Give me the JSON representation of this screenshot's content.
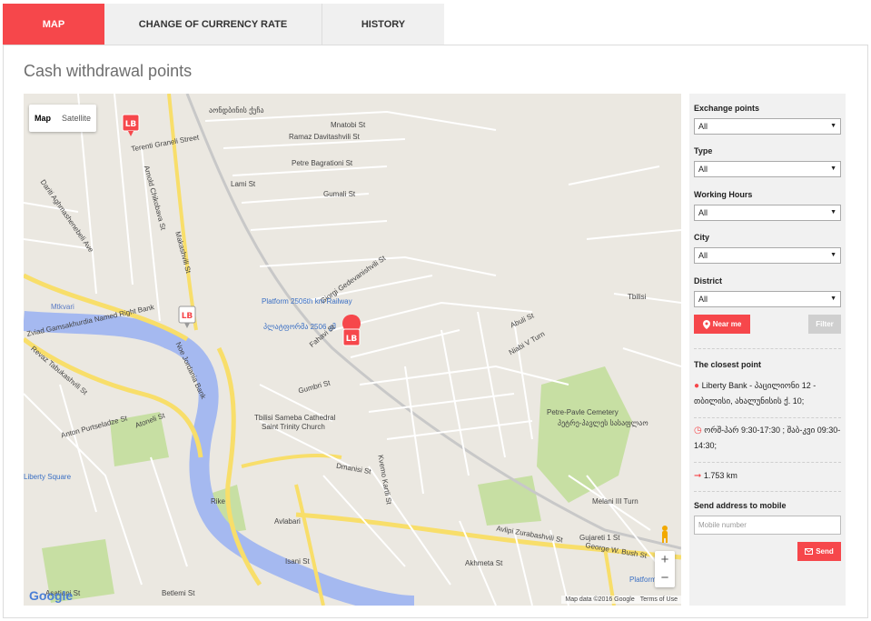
{
  "tabs": [
    {
      "label": "MAP",
      "active": true
    },
    {
      "label": "CHANGE OF CURRENCY RATE",
      "active": false
    },
    {
      "label": "HISTORY",
      "active": false
    }
  ],
  "page_title": "Cash withdrawal points",
  "map": {
    "map_type": {
      "map": "Map",
      "satellite": "Satellite"
    },
    "zoom": {
      "in": "+",
      "out": "−"
    },
    "logo": "Google",
    "attribution": {
      "data": "Map data ©2016 Google",
      "terms": "Terms of Use"
    },
    "labels": {
      "l1": "აონდბინის ქუჩა",
      "l2": "Mnatobi St",
      "l3": "Ramaz Davitashvili St",
      "l4": "Terenti Graneli Street",
      "l5": "Petre Bagrationi St",
      "l6": "Lami St",
      "l7": "Gumali St",
      "l8": "Arnold Chikobava St",
      "l9": "Dariti Aghmashenebeli Ave",
      "l10": "Makashvili St",
      "l11": "Giorgi Gedevanishvili St",
      "l12": "Platform 2506th km Railway",
      "l13": "პლატფორმა 2506 კმ",
      "l14": "Mtkvari",
      "l15": "Zviad Gamsakhurdia Named Right Bank",
      "l16": "Noe Jordania Bank",
      "l17": "Revaz Tabukashvili St",
      "l18": "Anton Purtseladze St",
      "l19": "Atoneli St",
      "l20": "Tbilisi Sameba Cathedral",
      "l21": "Saint Trinity Church",
      "l22": "Gumbri St",
      "l23": "Fahavi St",
      "l24": "Abuli St",
      "l25": "Niabi V Turn",
      "l26": "Petre-Pavle Cemetery",
      "l27": "პეტრე-პავლეს სასაფლაო",
      "l28": "Tbilisi",
      "l29": "Rike",
      "l30": "Avlabari",
      "l31": "Isani St",
      "l32": "Akhmeta St",
      "l33": "Avlipi Zurabashvili St",
      "l34": "George W. Bush St",
      "l35": "Liberty Square",
      "l36": "Gujareti 1 St",
      "l37": "Melani III Turn",
      "l38": "Betlemi St",
      "l39": "Asatiani St",
      "l40": "Platform",
      "l41": "Kvemo Kartli St",
      "l42": "Dmanisi St"
    }
  },
  "filters": {
    "exchange_points": {
      "label": "Exchange points",
      "value": "All"
    },
    "type": {
      "label": "Type",
      "value": "All"
    },
    "working_hours": {
      "label": "Working Hours",
      "value": "All"
    },
    "city": {
      "label": "City",
      "value": "All"
    },
    "district": {
      "label": "District",
      "value": "All"
    },
    "near_me": "Near me",
    "filter": "Filter"
  },
  "closest": {
    "title": "The closest point",
    "address": "Liberty Bank - პაცილიონი 12 - თბილისი, ახალუნისის ქ. 10;",
    "hours": "ორშ-პარ 9:30-17:30 ; შაბ-კვი 09:30-14:30;",
    "distance": "1.753 km"
  },
  "mobile": {
    "title": "Send address to mobile",
    "placeholder": "Mobile number",
    "send": "Send"
  },
  "colors": {
    "accent": "#f6474b",
    "river": "#a5b9f0",
    "major_road": "#f8de6a",
    "park": "#c7dfa3"
  }
}
